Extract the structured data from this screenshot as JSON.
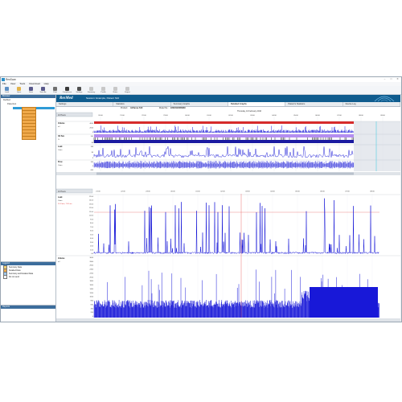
{
  "window": {
    "title": "ResScan"
  },
  "menu": [
    "File",
    "View",
    "Tools",
    "Download",
    "Help"
  ],
  "toolbar": [
    {
      "label": "Load",
      "icon": "load-icon",
      "color": "#5d8fc4"
    },
    {
      "label": "Open",
      "icon": "open-folder-icon",
      "color": "#e2b34a"
    },
    {
      "label": "Save",
      "icon": "save-icon",
      "color": "#5a5a8c"
    },
    {
      "label": "Save As",
      "icon": "save-as-icon",
      "color": "#5a5a8c"
    },
    {
      "label": "Print",
      "icon": "print-icon",
      "color": "#707070"
    },
    {
      "label": "Compliance",
      "icon": "compliance-icon",
      "color": "#3a3a3a"
    },
    {
      "label": "Settings",
      "icon": "settings-icon",
      "color": "#505050"
    },
    {
      "label": "Summary",
      "icon": "summary-icon",
      "color": "#c8c8c8"
    },
    {
      "label": "Profile",
      "icon": "profile-icon",
      "color": "#c8c8c8"
    },
    {
      "label": "Notes",
      "icon": "notes-icon",
      "color": "#c8c8c8"
    },
    {
      "label": "Export",
      "icon": "export-icon",
      "color": "#c8c8c8"
    }
  ],
  "sidebar": {
    "header": "Browser",
    "tree_root": "ResMed",
    "tree_child": "PatientList",
    "legend_header": "Legend",
    "legend_items": [
      {
        "label": "Summary Data",
        "color": "#f0d070"
      },
      {
        "label": "Detailed Data",
        "color": "#f0a94a"
      },
      {
        "label": "Summary and Detailed Data",
        "color": "#a0c8e8"
      },
      {
        "label": "Do not send",
        "color": "#ffffff"
      }
    ],
    "reports_header": "Reports"
  },
  "brand": {
    "logo": "ResMed",
    "patient_title": "Session: Example, Patient S10"
  },
  "tabs": [
    "Settings",
    "Statistics",
    "Summary Graphs",
    "Detailed Graphs",
    "Patient's Statistics",
    "Device Log"
  ],
  "active_tab": 3,
  "info": {
    "product_label": "Product:",
    "product_value": "AirSense S10",
    "model_label": "Model No.:",
    "model_value": "22323123336963"
  },
  "overview": {
    "date": "Thursday, 10 February 2016",
    "range_label": "10 Hours",
    "times": [
      "20:00",
      "21:00",
      "22:00",
      "23:00",
      "00:00",
      "01:00",
      "02:00",
      "03:00",
      "04:00",
      "05:00",
      "06:00",
      "07:00",
      "08:00",
      "09:00"
    ],
    "rows": [
      {
        "title": "Volume",
        "unit": "ml",
        "scale": [
          "4000",
          "2000",
          "0"
        ]
      },
      {
        "title": "O2 Sat.",
        "unit": "%",
        "scale": [
          "100",
          "80"
        ]
      },
      {
        "title": "Leak",
        "unit": "L/min",
        "scale": [
          "160",
          "80",
          "0"
        ]
      },
      {
        "title": "Flow",
        "unit": "L/min",
        "scale": [
          "100",
          "0",
          "-100"
        ]
      }
    ],
    "colors": {
      "volume_band": "#d62b2b",
      "o2_band": "#b48ef0",
      "trace": "#1212d6",
      "cursor": "#33c8e0"
    }
  },
  "detail": {
    "range_label": "10 Hours",
    "times": [
      "21:00",
      "22:00",
      "23:00",
      "00:00",
      "01:00",
      "02:00",
      "03:00",
      "04:00",
      "05:00",
      "06:00",
      "07:00",
      "08:00"
    ],
    "leak": {
      "title": "Leak",
      "unit": "L/min",
      "marker": "24 L/min, 7:20 am",
      "scale": [
        "150.0",
        "140.0",
        "130.0",
        "120.0",
        "110.0",
        "100.0",
        "90.0",
        "80.0",
        "70.0",
        "60.0",
        "50.0",
        "40.0",
        "30.0",
        "20.0",
        "10.0",
        "0.0"
      ]
    },
    "volume": {
      "title": "Volume",
      "unit": "ml",
      "scale": [
        "3000",
        "2800",
        "2600",
        "2400",
        "2200",
        "2000",
        "1800",
        "1600",
        "1400",
        "1200",
        "1000",
        "800",
        "600",
        "400",
        "200",
        "0"
      ]
    },
    "colors": {
      "trace": "#1818d8",
      "marker": "#e23b3b"
    }
  }
}
